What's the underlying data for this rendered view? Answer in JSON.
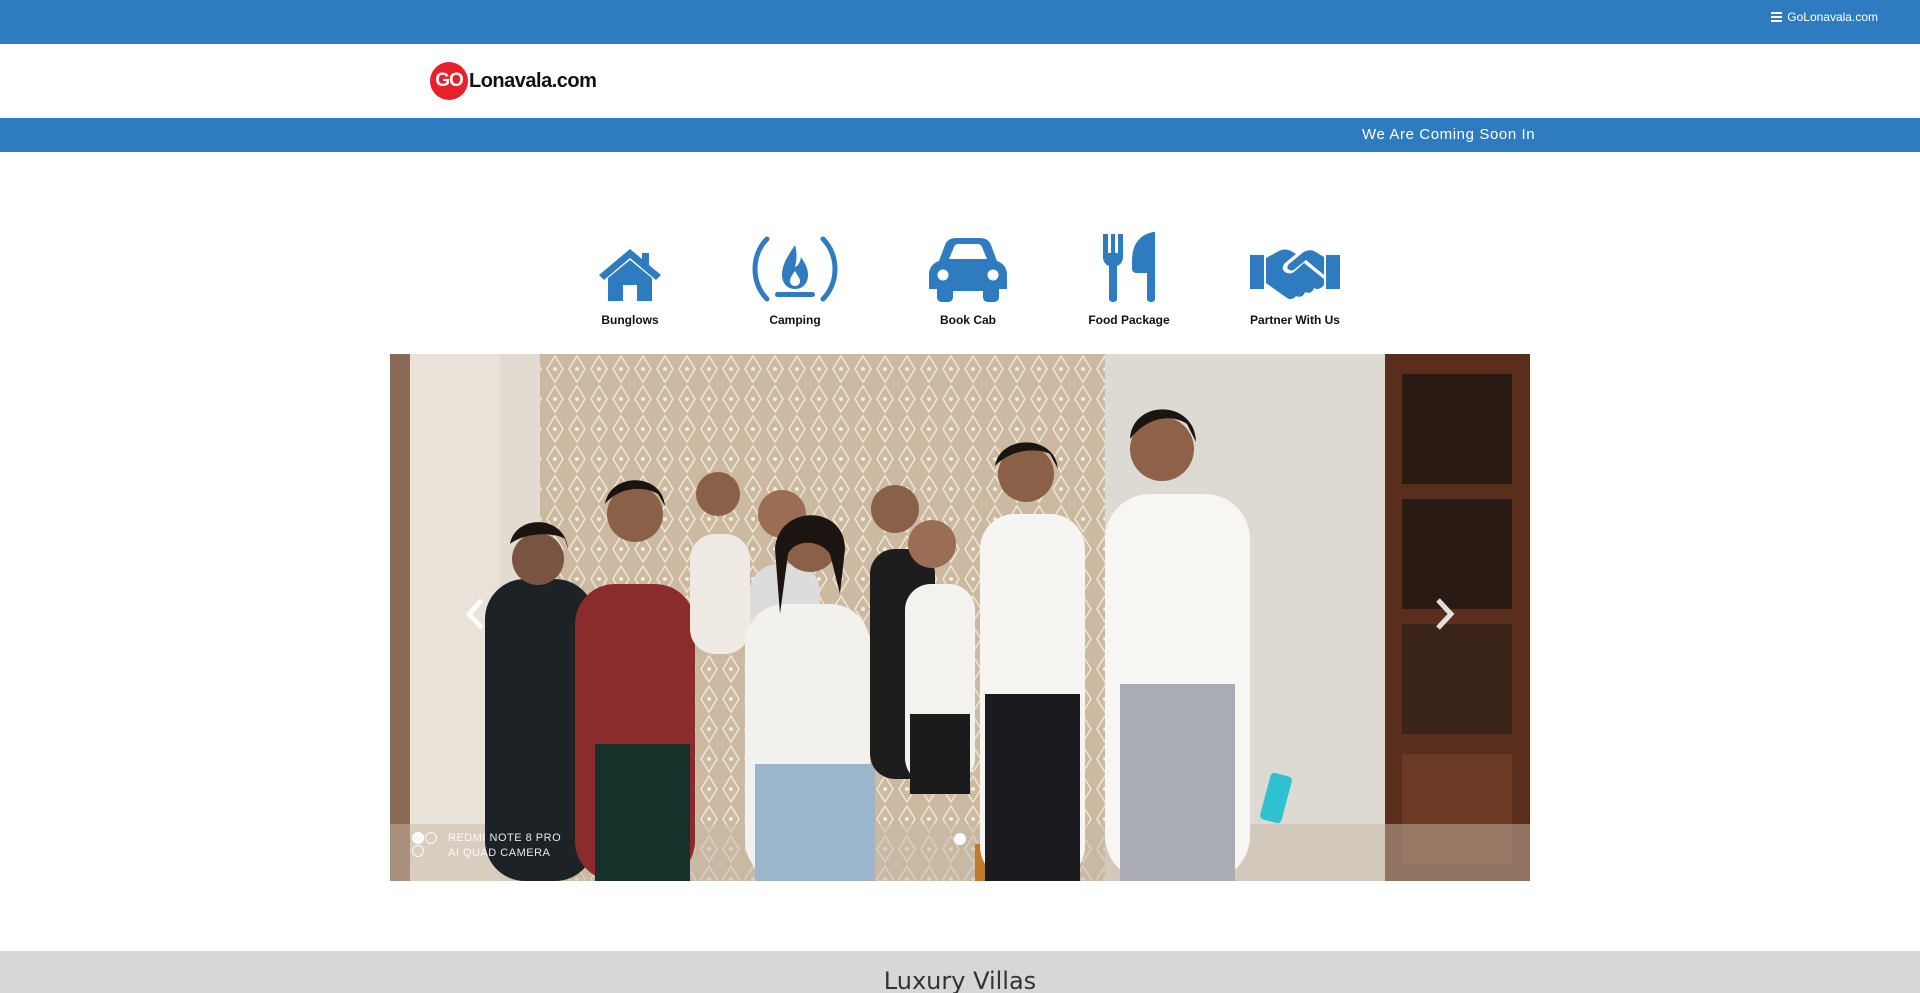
{
  "topbar": {
    "menu_label": "GoLonavala.com",
    "background": "#2f7bc0"
  },
  "header": {
    "logo_badge": "GO",
    "logo_text": "Lonavala.com",
    "badge_color": "#e8202a"
  },
  "announcement": {
    "text": "We Are Coming Soon In"
  },
  "services": [
    {
      "label": "Bunglows",
      "icon": "house-icon"
    },
    {
      "label": "Camping",
      "icon": "campfire-icon"
    },
    {
      "label": "Book Cab",
      "icon": "car-icon"
    },
    {
      "label": "Food Package",
      "icon": "utensils-icon"
    },
    {
      "label": "Partner With Us",
      "icon": "handshake-icon"
    }
  ],
  "accent_color": "#2f7bc0",
  "carousel": {
    "prev_icon": "chevron-left-icon",
    "next_icon": "chevron-right-icon",
    "slide_count": 1,
    "active_index": 0,
    "watermark_line1": "REDMI NOTE 8 PRO",
    "watermark_line2": "AI QUAD CAMERA"
  },
  "section": {
    "title": "Luxury Villas"
  }
}
